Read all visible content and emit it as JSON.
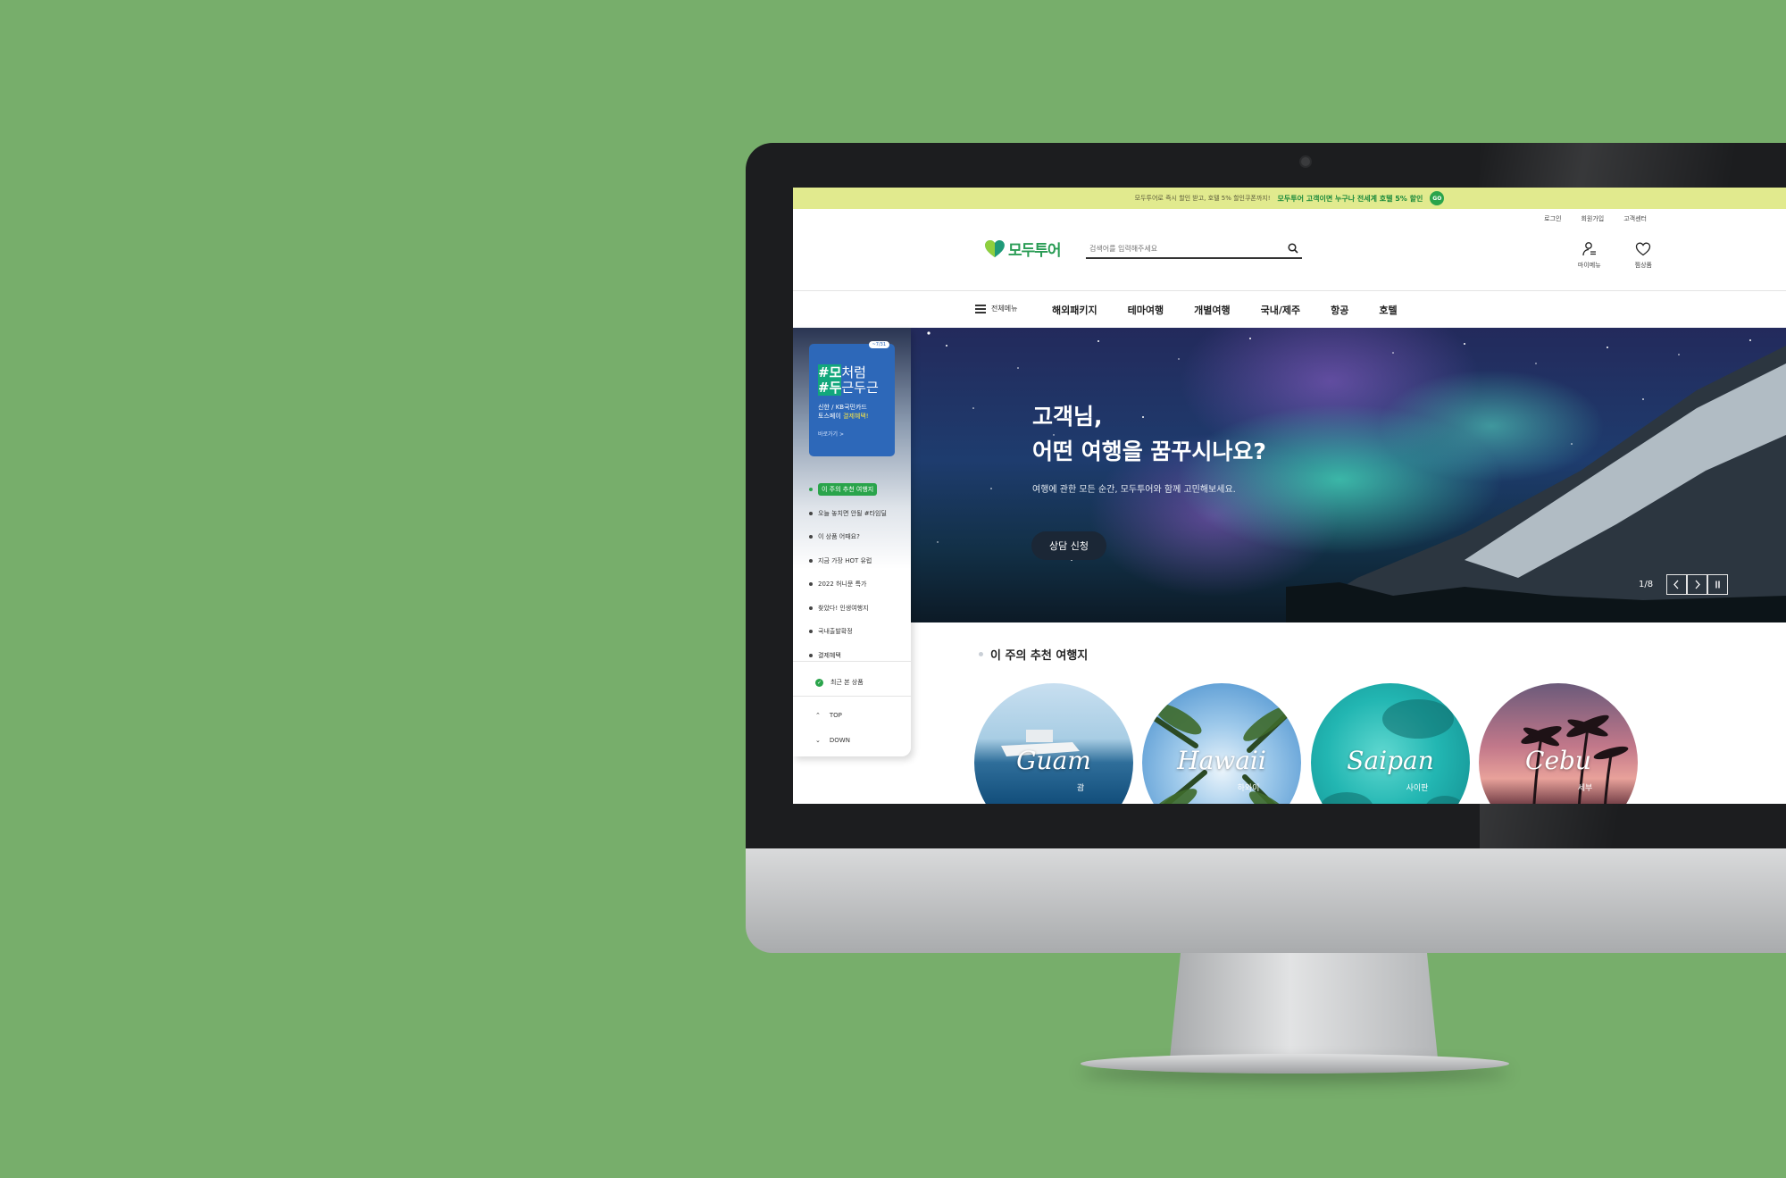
{
  "banner": {
    "text": "모두투어로 즉시 할인 받고, 호텔 5% 할인쿠폰까지!",
    "highlight": "모두투어 고객이면 누구나 전세계 호텔 5% 할인",
    "go": "GO"
  },
  "util_links": [
    "로그인",
    "회원가입",
    "고객센터"
  ],
  "logo": {
    "text": "모두투어"
  },
  "search": {
    "placeholder": "검색어를 입력해주세요"
  },
  "header_icons": {
    "mymenu": "마이메뉴",
    "wishlist": "찜상품"
  },
  "nav": {
    "all_menu": "전체메뉴",
    "items": [
      "해외패키지",
      "테마여행",
      "개별여행",
      "국내/제주",
      "항공",
      "호텔"
    ]
  },
  "hero": {
    "title_line1": "고객님,",
    "title_line2": "어떤 여행을 꿈꾸시나요?",
    "subtitle": "여행에 관한 모든 순간, 모두투어와 함께 고민해보세요.",
    "button": "상담 신청",
    "counter": "1/8"
  },
  "sidebar": {
    "promo": {
      "date": "~7/31",
      "hash1": "#모",
      "title1": "처럼",
      "hash2": "#두",
      "title2": "근두근",
      "desc1": "신한 / KB국민카드",
      "desc2": "토스페이",
      "desc2_highlight": "결제혜택!",
      "link": "바로가기 >"
    },
    "items": [
      "이 주의 추천 여행지",
      "오늘 놓치면 안될 #타임딜",
      "이 상품 어때요?",
      "지금 가장 HOT 유럽",
      "2022 허니문 특가",
      "찾았다! 인생여행지",
      "국내출발확정",
      "결제혜택"
    ],
    "recent": "최근 본 상품",
    "top": "TOP",
    "down": "DOWN"
  },
  "recommended": {
    "title": "이 주의 추천 여행지",
    "destinations": [
      {
        "name": "Guam",
        "kr": "괌"
      },
      {
        "name": "Hawaii",
        "kr": "하와이"
      },
      {
        "name": "Saipan",
        "kr": "사이판"
      },
      {
        "name": "Cebu",
        "kr": "세부"
      }
    ]
  },
  "colors": {
    "background": "#77ae6b",
    "banner": "#e1ea8e",
    "brand_green": "#2a9c55",
    "promo_blue": "#2d68b9",
    "hero_button": "#1b2736"
  }
}
